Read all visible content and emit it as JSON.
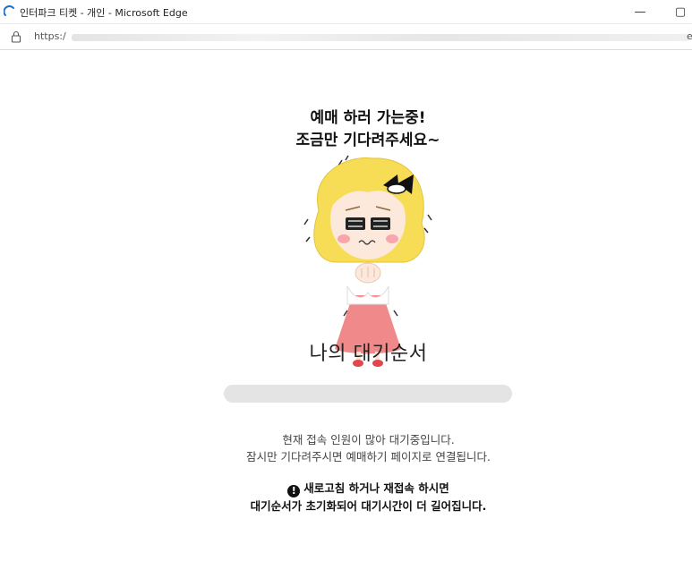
{
  "window": {
    "title": "인터파크 티켓 - 개인 - Microsoft Edge",
    "minimize_glyph": "—",
    "maximize_glyph": "▢"
  },
  "address_bar": {
    "url_prefix": "https:/",
    "url_suffix": "e"
  },
  "illustration": {
    "handwritten_text_line1": "예매 하러 가는중!",
    "handwritten_text_line2": "조금만 기다려주세요~",
    "icon": "waiting-girl-illustration"
  },
  "queue": {
    "title": "나의 대기순서",
    "progress_percent": 0
  },
  "info": {
    "line1": "현재 접속 인원이 많아 대기중입니다.",
    "line2": "잠시만 기다려주시면 예매하기 페이지로 연결됩니다."
  },
  "warning": {
    "icon_glyph": "!",
    "line1": "새로고침 하거나 재접속 하시면",
    "line2": "대기순서가 초기화되어 대기시간이 더 길어집니다."
  },
  "colors": {
    "hair": "#f7dd55",
    "dress": "#f08a8a",
    "progress_track": "#e4e4e4"
  }
}
